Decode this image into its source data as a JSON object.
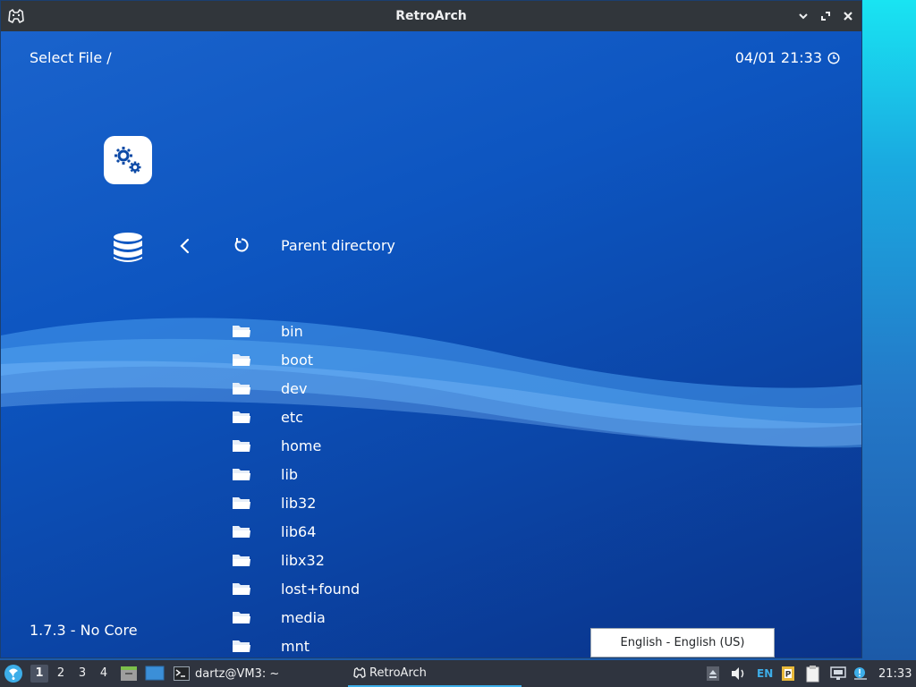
{
  "window": {
    "title": "RetroArch",
    "buttons": [
      "minimize-icon",
      "maximize-icon",
      "close-icon"
    ]
  },
  "retroarch": {
    "header_title": "Select File /",
    "datetime": "04/01 21:33",
    "version_core": "1.7.3 - No Core",
    "parent_directory": "Parent directory",
    "files": [
      "bin",
      "boot",
      "dev",
      "etc",
      "home",
      "lib",
      "lib32",
      "lib64",
      "libx32",
      "lost+found",
      "media",
      "mnt"
    ]
  },
  "language_popup": "English - English (US)",
  "taskbar": {
    "workspaces": [
      "1",
      "2",
      "3",
      "4"
    ],
    "active_workspace": "1",
    "tasks": [
      {
        "label": "dartz@VM3: ~",
        "icon": "terminal-icon"
      },
      {
        "label": "RetroArch",
        "icon": "retroarch-icon"
      }
    ],
    "tray": {
      "keyboard_layout": "EN",
      "clock": "21:33"
    }
  },
  "colors": {
    "titlebar": "#31363b",
    "taskbar": "#2f343f",
    "content_blue": "#0d55c0",
    "accent": "#3daee9"
  }
}
